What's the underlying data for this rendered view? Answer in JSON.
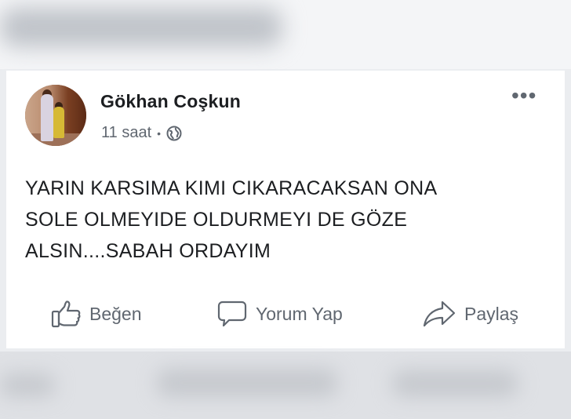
{
  "post": {
    "author": "Gökhan Coşkun",
    "time": "11 saat",
    "separator": "•",
    "more_label": "•••",
    "privacy_icon": "globe-icon",
    "text_lines": [
      "YARIN KARSIMA KIMI CIKARACAKSAN ONA",
      "SOLE OLMEYIDE OLDURMEYI DE GÖZE",
      "ALSIN....SABAH ORDAYIM"
    ]
  },
  "actions": {
    "like_label": "Beğen",
    "comment_label": "Yorum Yap",
    "share_label": "Paylaş"
  },
  "colors": {
    "text_primary": "#1c1e21",
    "text_secondary": "#606770",
    "card_bg": "#ffffff",
    "page_bg": "#ebedf0"
  }
}
